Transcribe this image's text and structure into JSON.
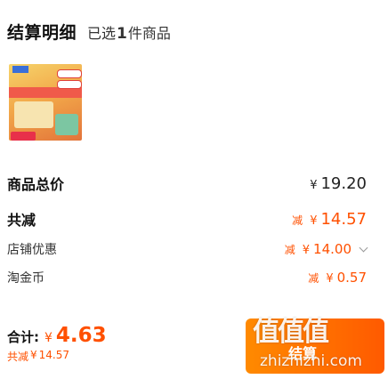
{
  "header": {
    "title": "结算明细",
    "selected_prefix": "已选",
    "selected_count": "1",
    "selected_suffix": "件商品"
  },
  "product": {
    "thumbnail": "book-cover-thumbnail"
  },
  "summary": {
    "total_label": "商品总价",
    "total_currency": "¥",
    "total_value": "19.20",
    "discount_label": "共减",
    "discount_mark": "减",
    "discount_currency": "¥",
    "discount_value": "14.57",
    "store_label": "店铺优惠",
    "store_mark": "减",
    "store_currency": "¥",
    "store_value": "14.00",
    "coin_label": "淘金币",
    "coin_mark": "减",
    "coin_currency": "¥",
    "coin_value": "0.57"
  },
  "footer": {
    "sum_label": "合计:",
    "sum_currency": "¥",
    "sum_value": "4.63",
    "saved_label": "共减",
    "saved_currency": "¥",
    "saved_value": "14.57",
    "checkout_label": "结算"
  },
  "watermark": {
    "cn": "值值值",
    "en": "zhizhizhi.com"
  },
  "colors": {
    "accent": "#ff5000",
    "button_start": "#ff8a00",
    "button_end": "#ff5a00"
  }
}
